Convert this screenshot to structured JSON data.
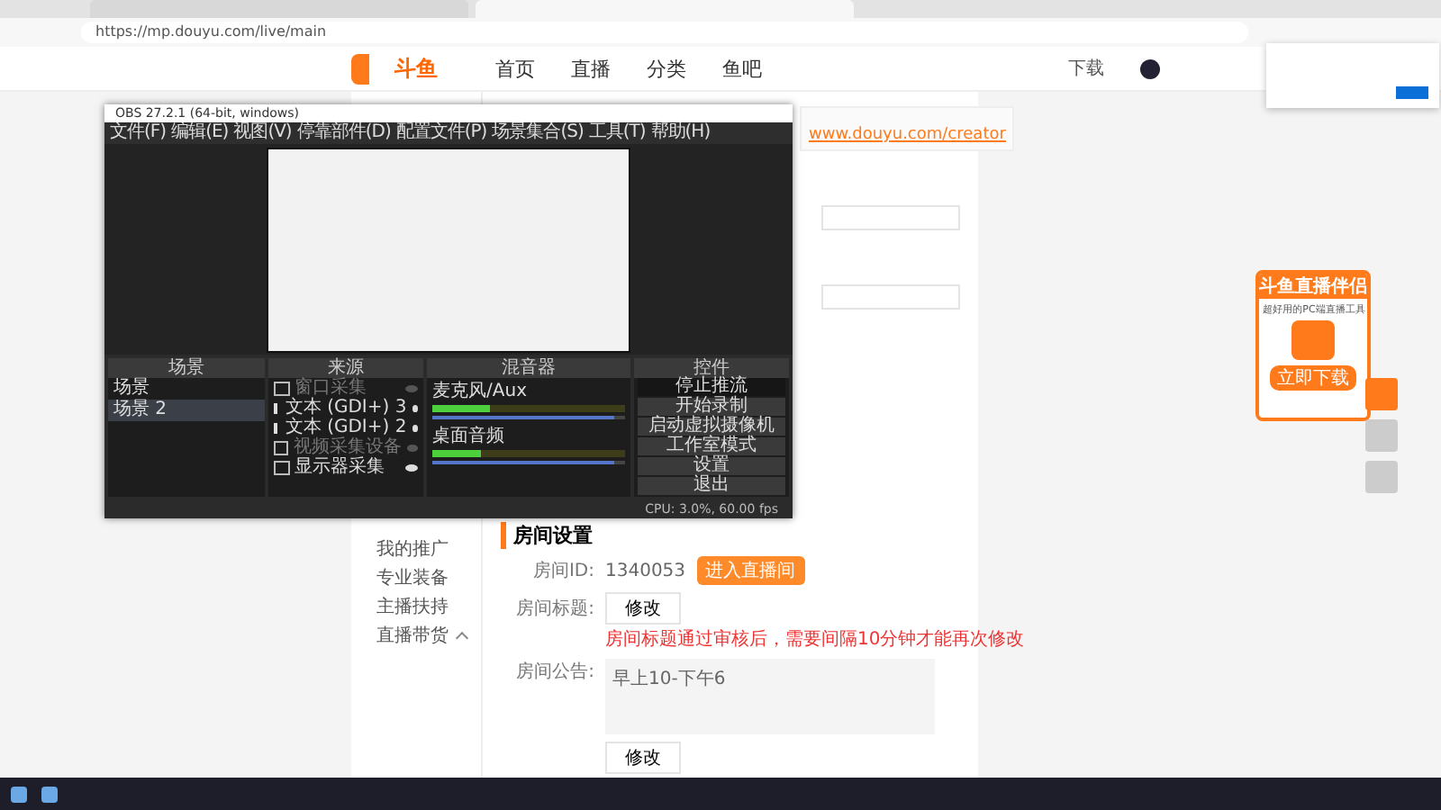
{
  "browser": {
    "url": "https://mp.douyu.com/live/main"
  },
  "site_header": {
    "logo": "斗鱼",
    "nav": [
      "首页",
      "直播",
      "分类",
      "鱼吧"
    ],
    "download": "下载"
  },
  "notice": {
    "link": "www.douyu.com/creator"
  },
  "sidebar": {
    "items": [
      {
        "label": "我的推广"
      },
      {
        "label": "专业装备"
      },
      {
        "label": "主播扶持"
      },
      {
        "label": "直播带货",
        "expanded": true
      }
    ]
  },
  "room_settings": {
    "title": "房间设置",
    "room_id_label": "房间ID:",
    "room_id": "1340053",
    "enter_button": "进入直播间",
    "title_label": "房间标题:",
    "edit_button": "修改",
    "title_hint": "房间标题通过审核后，需要间隔10分钟才能再次修改",
    "notice_label": "房间公告:",
    "notice_value": "早上10-下午6",
    "notice_edit_button": "修改"
  },
  "obs": {
    "title": "OBS 27.2.1 (64-bit, windows)",
    "menu": [
      "文件(F)",
      "编辑(E)",
      "视图(V)",
      "停靠部件(D)",
      "配置文件(P)",
      "场景集合(S)",
      "工具(T)",
      "帮助(H)"
    ],
    "docks": [
      "场景",
      "来源",
      "混音器",
      "控件"
    ],
    "scenes": [
      {
        "name": "场景",
        "selected": false
      },
      {
        "name": "场景 2",
        "selected": true
      }
    ],
    "sources": [
      {
        "name": "窗口采集",
        "kind": "window",
        "visible": false
      },
      {
        "name": "文本 (GDI+) 3",
        "kind": "text",
        "visible": true
      },
      {
        "name": "文本 (GDI+) 2",
        "kind": "text",
        "visible": true
      },
      {
        "name": "视频采集设备",
        "kind": "camera",
        "visible": false
      },
      {
        "name": "显示器采集",
        "kind": "monitor",
        "visible": true
      }
    ],
    "mixer": [
      {
        "name": "麦克风/Aux",
        "level": 0.3,
        "fader": {
          "level": 0.95
        }
      },
      {
        "name": "桌面音频",
        "level": 0.25,
        "fader": {
          "level": 0.95
        }
      }
    ],
    "controls": [
      {
        "label": "停止推流",
        "active": true
      },
      {
        "label": "开始录制",
        "active": false
      },
      {
        "label": "启动虚拟摄像机",
        "active": false
      },
      {
        "label": "工作室模式",
        "active": false
      },
      {
        "label": "设置",
        "active": false
      },
      {
        "label": "退出",
        "active": false
      }
    ],
    "status": "CPU: 3.0%, 60.00 fps"
  },
  "companion_ad": {
    "title": "斗鱼直播伴侣",
    "subtitle": "超好用的PC端直播工具",
    "button": "立即下载"
  }
}
